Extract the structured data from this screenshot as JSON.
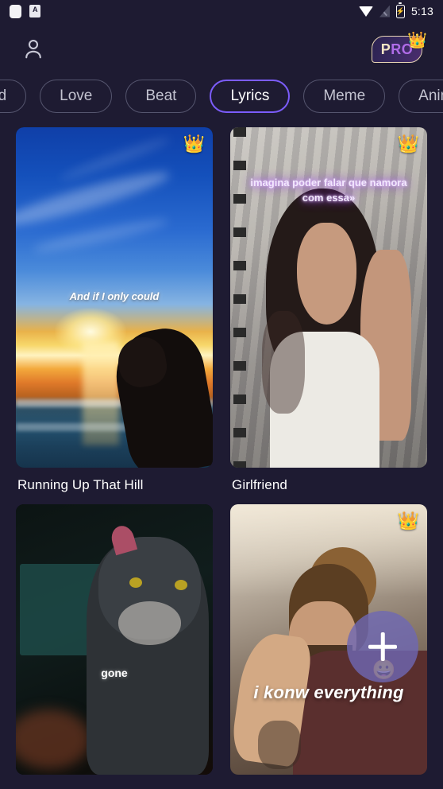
{
  "status_bar": {
    "time": "5:13",
    "icons": [
      "app-square-icon",
      "a-badge-icon",
      "wifi-icon",
      "signal-off-icon",
      "battery-charging-icon"
    ]
  },
  "header": {
    "avatar_icon": "person-icon",
    "pro_label_part1": "P",
    "pro_label_part2": "RO",
    "pro_crown_icon": "crown-icon"
  },
  "categories": {
    "items": [
      {
        "label": "ed",
        "selected": false
      },
      {
        "label": "Love",
        "selected": false
      },
      {
        "label": "Beat",
        "selected": false
      },
      {
        "label": "Lyrics",
        "selected": true
      },
      {
        "label": "Meme",
        "selected": false
      },
      {
        "label": "Anime",
        "selected": false
      }
    ],
    "selected": "Lyrics"
  },
  "fab": {
    "icon": "plus-icon",
    "label": "+"
  },
  "cards": [
    {
      "title": "Running Up That Hill",
      "overlay_text": "And if I only could",
      "pro_badge": true,
      "badge_icon": "crown-icon"
    },
    {
      "title": "Girlfriend",
      "overlay_text": "imagina poder falar que namora com essa»",
      "pro_badge": true,
      "badge_icon": "crown-icon"
    },
    {
      "title": "",
      "overlay_text": "gone",
      "pro_badge": false,
      "badge_icon": ""
    },
    {
      "title": "",
      "overlay_text": "i konw everything",
      "pro_badge": true,
      "badge_icon": "crown-icon",
      "sticker": "😀"
    }
  ],
  "colors": {
    "background": "#1e1b32",
    "accent": "#7b5cfa",
    "chip_border": "#55556e",
    "text_primary": "#ffffff",
    "text_secondary": "#c3c3d0",
    "pro_gold": "#f3e3c4"
  }
}
